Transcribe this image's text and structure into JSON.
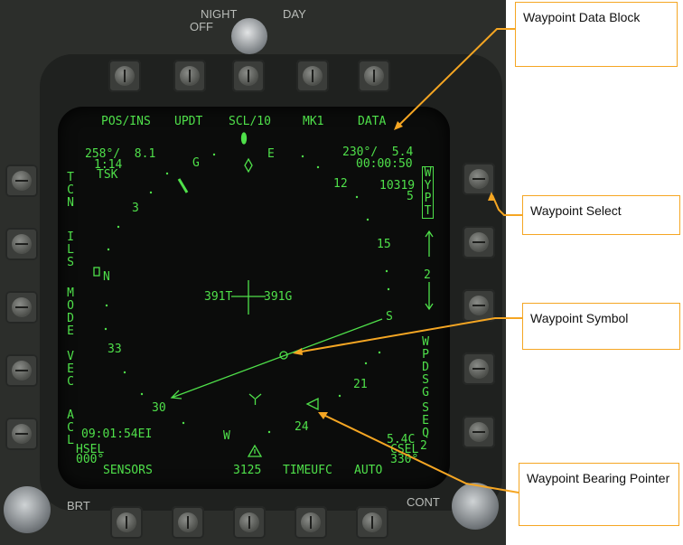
{
  "panel": {
    "night_label": "NIGHT",
    "off_label": "OFF",
    "day_label": "DAY",
    "brt_label": "BRT",
    "cont_label": "CONT"
  },
  "display": {
    "top_options": [
      "POS/INS",
      "UPDT",
      "SCL/10",
      "MK1",
      "DATA"
    ],
    "left_options": {
      "tcn": "TCN",
      "ils": "ILS",
      "mode": "MODE",
      "vec": "VEC",
      "acl": "ACL"
    },
    "right_options": {
      "wypt": "WYPT",
      "wpdsg": "WPDSG",
      "seq": "SEQ",
      "seq_num": "2"
    },
    "bottom_options": [
      "SENSORS",
      "3125",
      "TIMEUFC",
      "AUTO"
    ],
    "top_left_data": {
      "bearing_range": "258°/  8.1",
      "time": "1:14",
      "tsk": "TSK"
    },
    "top_right_data": {
      "bearing_range": "230°/  5.4",
      "time": "00:00:50",
      "elevation": "10319",
      "waypoint_num": "5"
    },
    "heading_readouts": {
      "true": "391T",
      "ground": "391G"
    },
    "clock": "09:01:54EI",
    "hsel": "HSEL",
    "hsel_value": "000°",
    "bottom_right": {
      "line1": "5.4C",
      "line2": "CSEL",
      "line3": "330°"
    },
    "waypoint_step": "2",
    "compass_labels": [
      "E",
      "G",
      "12",
      "3",
      "15",
      "N",
      "S",
      "33",
      "21",
      "30",
      "24",
      "W"
    ]
  },
  "callouts": {
    "data_block": "Waypoint Data Block",
    "select": "Waypoint Select",
    "symbol": "Waypoint Symbol",
    "bearing_pointer": "Waypoint Bearing Pointer"
  },
  "colors": {
    "mfd_green": "#4fe04a",
    "callout_orange": "#f5a623"
  }
}
